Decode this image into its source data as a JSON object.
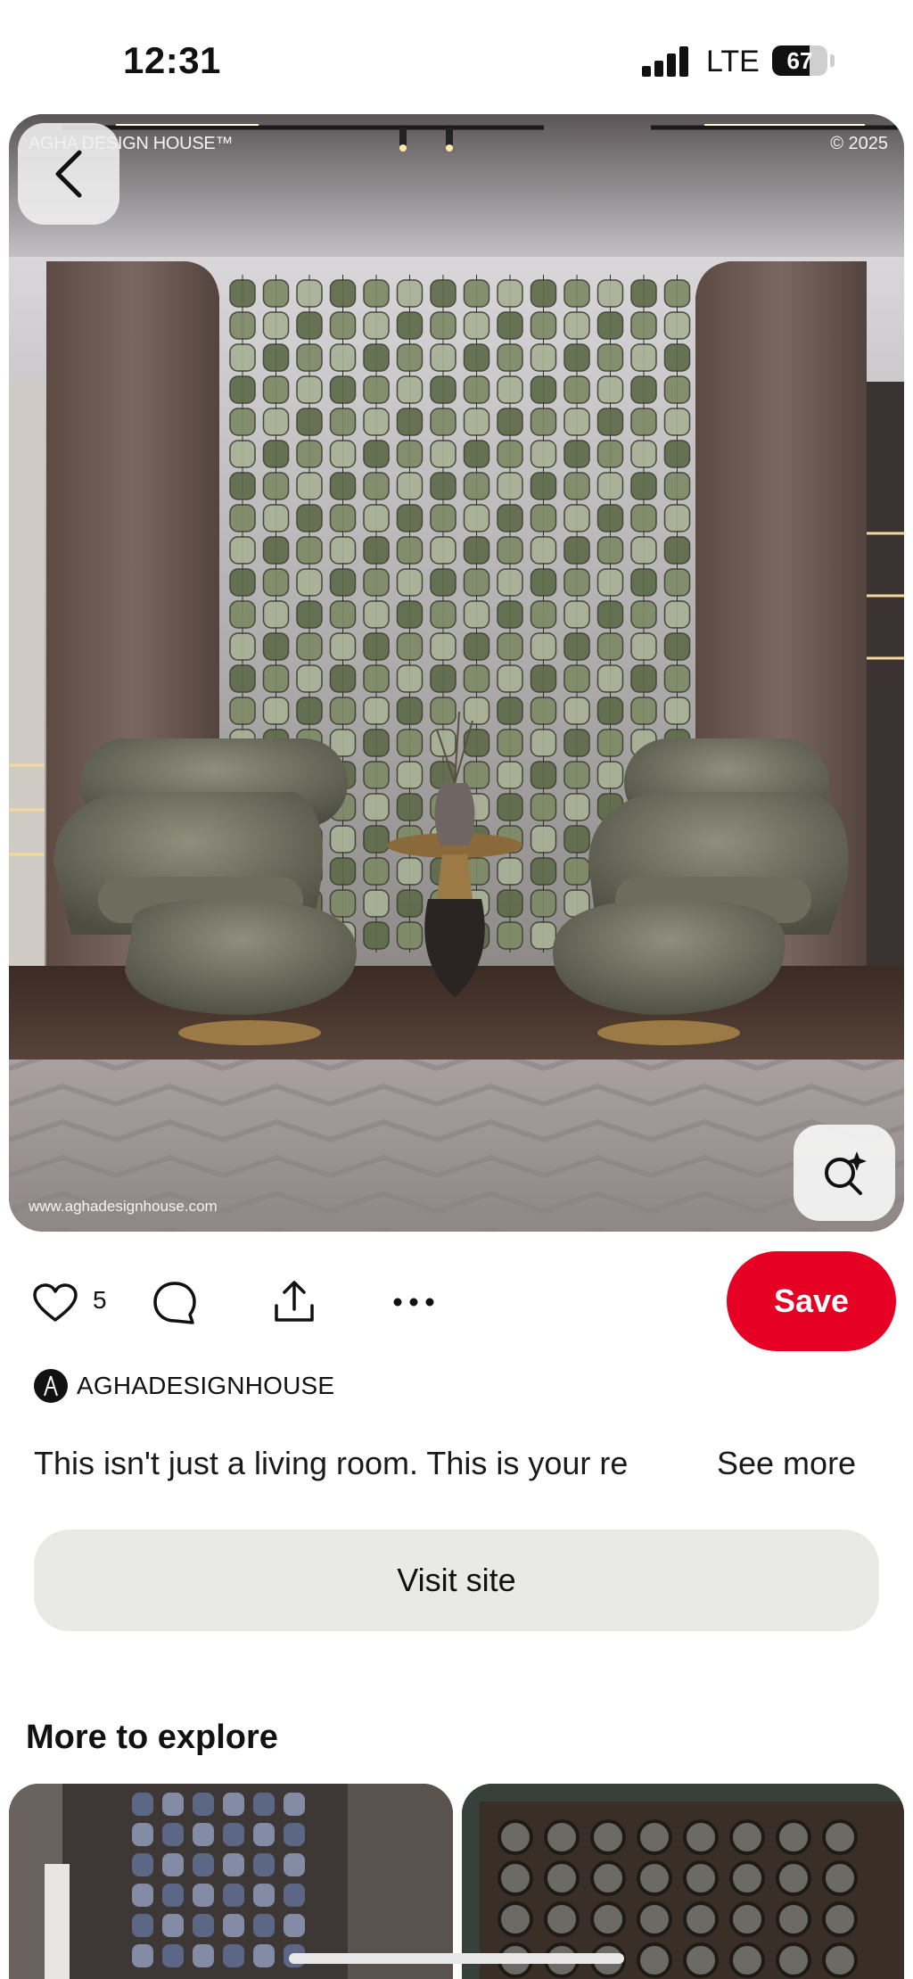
{
  "status_bar": {
    "time": "12:31",
    "network": "LTE",
    "battery": "67",
    "battery_level": 0.67
  },
  "pin": {
    "watermark_brand": "AGHA DESIGN HOUSE™",
    "watermark_copyright": "© 2025",
    "watermark_url": "www.aghadesignhouse.com",
    "back_icon": "chevron-left-icon",
    "visual_search_icon": "sparkle-search-icon"
  },
  "actions": {
    "like_icon": "heart-icon",
    "like_count": "5",
    "comment_icon": "comment-bubble-icon",
    "share_icon": "share-upload-icon",
    "more_icon": "ellipsis-icon",
    "save_label": "Save",
    "save_color": "#e60023"
  },
  "creator": {
    "name": "AGHADESIGNHOUSE"
  },
  "description": {
    "text": "This isn't just a living room. This is your re",
    "see_more": "See more"
  },
  "visit_site_label": "Visit site",
  "more_to_explore": {
    "title": "More to explore"
  },
  "colors": {
    "accent": "#e60023",
    "secondary_button": "#e9e9e6",
    "text": "#111111"
  }
}
